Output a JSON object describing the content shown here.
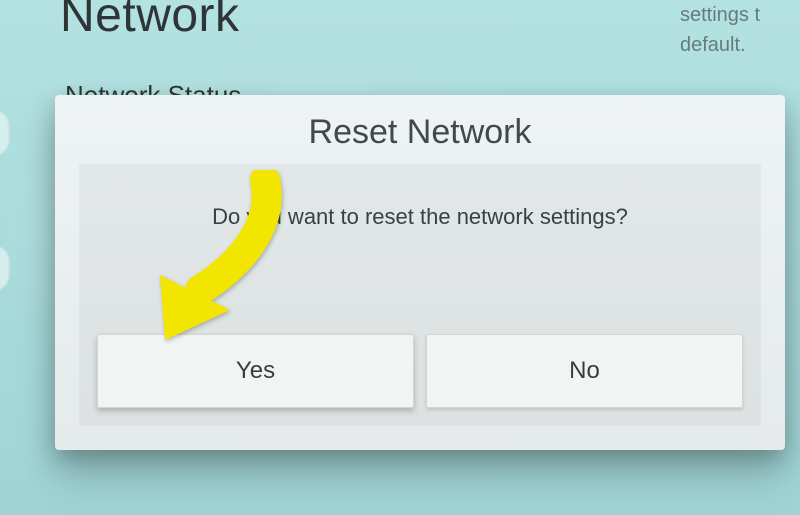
{
  "page": {
    "title": "Network",
    "menu_item": "Network Status",
    "hint": "settings t\ndefault."
  },
  "dialog": {
    "title": "Reset Network",
    "message": "Do you want to reset the network settings?",
    "yes_label": "Yes",
    "no_label": "No"
  },
  "annotation": {
    "arrow_color": "#f2e600"
  }
}
